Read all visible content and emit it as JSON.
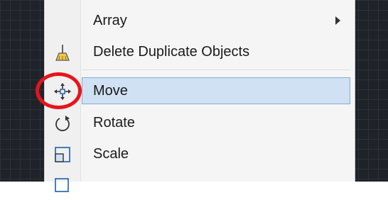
{
  "menu": {
    "items": [
      {
        "label": "Array",
        "icon": "none",
        "has_submenu": true
      },
      {
        "label": "Delete Duplicate Objects",
        "icon": "broom-icon"
      },
      {
        "label": "Move",
        "icon": "move-arrows-icon",
        "highlighted": true
      },
      {
        "label": "Rotate",
        "icon": "rotate-icon"
      },
      {
        "label": "Scale",
        "icon": "scale-icon"
      }
    ]
  },
  "colors": {
    "canvas": "#1f2329",
    "menu_bg": "#f5f5f5",
    "highlight": "#cfe1f3",
    "callout": "#e8141b"
  }
}
